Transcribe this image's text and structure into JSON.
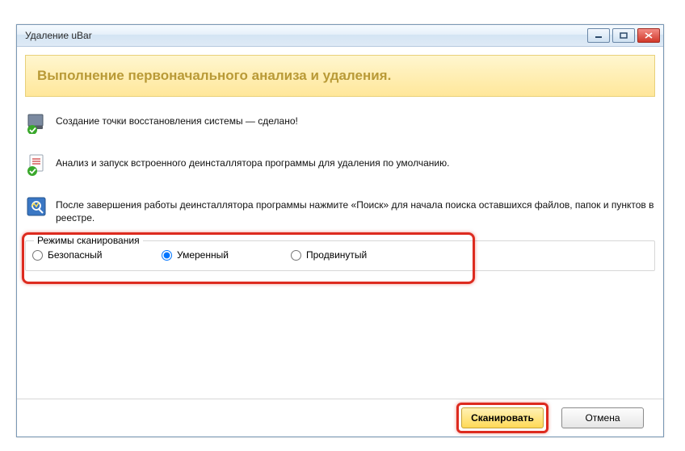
{
  "window": {
    "title": "Удаление uBar"
  },
  "banner": {
    "title": "Выполнение первоначального анализа и удаления."
  },
  "steps": {
    "restore": "Создание точки восстановления системы — сделано!",
    "uninstaller": "Анализ и запуск встроенного деинсталлятора программы для удаления по умолчанию.",
    "search": "После завершения работы деинсталлятора программы нажмите «Поиск» для начала поиска оставшихся файлов, папок и пунктов в реестре."
  },
  "scan_modes": {
    "legend": "Режимы сканирования",
    "options": {
      "safe": "Безопасный",
      "moderate": "Умеренный",
      "advanced": "Продвинутый"
    },
    "selected": "moderate"
  },
  "buttons": {
    "scan": "Сканировать",
    "cancel": "Отмена"
  },
  "icons": {
    "minimize": "minimize-icon",
    "maximize": "maximize-icon",
    "close": "close-icon",
    "restore_point": "server-check-icon",
    "uninstaller": "document-check-icon",
    "search": "tool-search-icon"
  }
}
